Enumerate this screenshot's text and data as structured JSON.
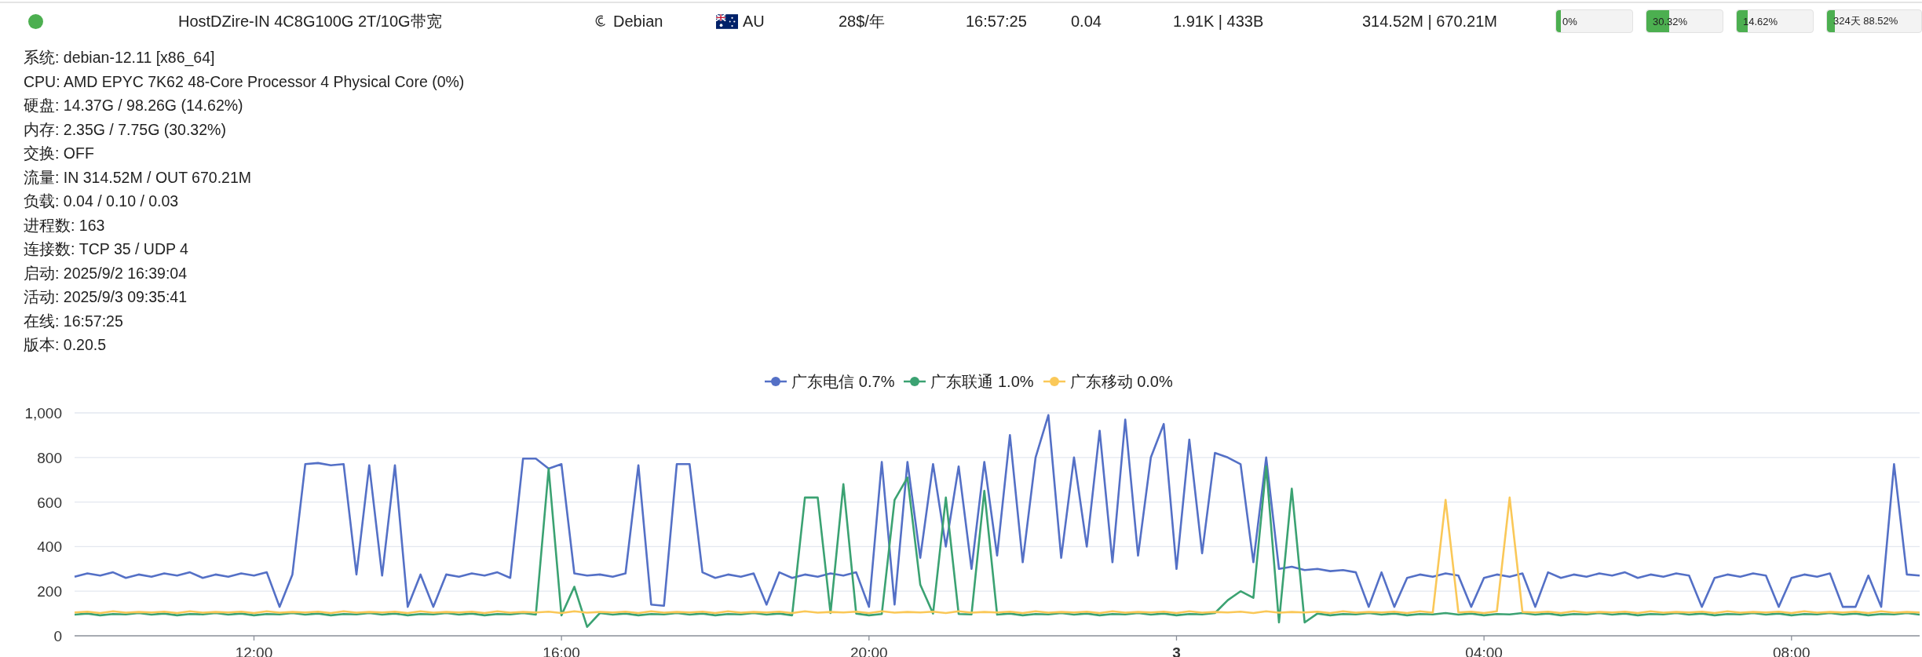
{
  "server": {
    "online": true,
    "name": "HostDZire-IN 4C8G100G 2T/10G带宽",
    "os": "Debian",
    "region": "AU",
    "price": "28$/年",
    "uptime": "16:57:25",
    "load": "0.04",
    "speed": "1.91K | 433B",
    "traffic": "314.52M | 670.21M",
    "bars": [
      {
        "label": "0%",
        "level": 0.0
      },
      {
        "label": "30.32%",
        "level": 0.3032
      },
      {
        "label": "14.62%",
        "level": 0.1462
      },
      {
        "label": "324天 88.52%",
        "level": 0.08
      }
    ]
  },
  "details": [
    "系统: debian-12.11 [x86_64]",
    "CPU: AMD EPYC 7K62 48-Core Processor 4 Physical Core (0%)",
    "硬盘: 14.37G / 98.26G (14.62%)",
    "内存: 2.35G / 7.75G (30.32%)",
    "交换: OFF",
    "流量: IN 314.52M / OUT 670.21M",
    "负载: 0.04 / 0.10 / 0.03",
    "进程数: 163",
    "连接数: TCP 35 / UDP 4",
    "启动: 2025/9/2 16:39:04",
    "活动: 2025/9/3 09:35:41",
    "在线: 16:57:25",
    "版本: 0.20.5"
  ],
  "latency": {
    "chart_data": {
      "type": "line",
      "grid": true,
      "xlim": [
        "2025-09-02 09:40",
        "2025-09-03 09:40"
      ],
      "ylim": [
        0,
        1000
      ],
      "yticks": [
        0,
        200,
        400,
        600,
        800,
        {
          "value": 1000,
          "label": "1,000"
        }
      ],
      "xticks": [
        {
          "value": "2025-09-02 12:00",
          "label": "12:00"
        },
        {
          "value": "2025-09-02 16:00",
          "label": "16:00"
        },
        {
          "value": "2025-09-02 20:00",
          "label": "20:00"
        },
        {
          "value": "2025-09-03 00:00",
          "label": "3"
        },
        {
          "value": "2025-09-03 04:00",
          "label": "04:00"
        },
        {
          "value": "2025-09-03 08:00",
          "label": "08:00"
        }
      ],
      "x": [
        "2025-09-02 09:40",
        "2025-09-02 09:50",
        "2025-09-02 10:00",
        "2025-09-02 10:10",
        "2025-09-02 10:20",
        "2025-09-02 10:30",
        "2025-09-02 10:40",
        "2025-09-02 10:50",
        "2025-09-02 11:00",
        "2025-09-02 11:10",
        "2025-09-02 11:20",
        "2025-09-02 11:30",
        "2025-09-02 11:40",
        "2025-09-02 11:50",
        "2025-09-02 12:00",
        "2025-09-02 12:10",
        "2025-09-02 12:20",
        "2025-09-02 12:30",
        "2025-09-02 12:40",
        "2025-09-02 12:50",
        "2025-09-02 13:00",
        "2025-09-02 13:10",
        "2025-09-02 13:20",
        "2025-09-02 13:30",
        "2025-09-02 13:40",
        "2025-09-02 13:50",
        "2025-09-02 14:00",
        "2025-09-02 14:10",
        "2025-09-02 14:20",
        "2025-09-02 14:30",
        "2025-09-02 14:40",
        "2025-09-02 14:50",
        "2025-09-02 15:00",
        "2025-09-02 15:10",
        "2025-09-02 15:20",
        "2025-09-02 15:30",
        "2025-09-02 15:40",
        "2025-09-02 15:50",
        "2025-09-02 16:00",
        "2025-09-02 16:10",
        "2025-09-02 16:20",
        "2025-09-02 16:30",
        "2025-09-02 16:40",
        "2025-09-02 16:50",
        "2025-09-02 17:00",
        "2025-09-02 17:10",
        "2025-09-02 17:20",
        "2025-09-02 17:30",
        "2025-09-02 17:40",
        "2025-09-02 17:50",
        "2025-09-02 18:00",
        "2025-09-02 18:10",
        "2025-09-02 18:20",
        "2025-09-02 18:30",
        "2025-09-02 18:40",
        "2025-09-02 18:50",
        "2025-09-02 19:00",
        "2025-09-02 19:10",
        "2025-09-02 19:20",
        "2025-09-02 19:30",
        "2025-09-02 19:40",
        "2025-09-02 19:50",
        "2025-09-02 20:00",
        "2025-09-02 20:10",
        "2025-09-02 20:20",
        "2025-09-02 20:30",
        "2025-09-02 20:40",
        "2025-09-02 20:50",
        "2025-09-02 21:00",
        "2025-09-02 21:10",
        "2025-09-02 21:20",
        "2025-09-02 21:30",
        "2025-09-02 21:40",
        "2025-09-02 21:50",
        "2025-09-02 22:00",
        "2025-09-02 22:10",
        "2025-09-02 22:20",
        "2025-09-02 22:30",
        "2025-09-02 22:40",
        "2025-09-02 22:50",
        "2025-09-02 23:00",
        "2025-09-02 23:10",
        "2025-09-02 23:20",
        "2025-09-02 23:30",
        "2025-09-02 23:40",
        "2025-09-02 23:50",
        "2025-09-03 00:00",
        "2025-09-03 00:10",
        "2025-09-03 00:20",
        "2025-09-03 00:30",
        "2025-09-03 00:40",
        "2025-09-03 00:50",
        "2025-09-03 01:00",
        "2025-09-03 01:10",
        "2025-09-03 01:20",
        "2025-09-03 01:30",
        "2025-09-03 01:40",
        "2025-09-03 01:50",
        "2025-09-03 02:00",
        "2025-09-03 02:10",
        "2025-09-03 02:20",
        "2025-09-03 02:30",
        "2025-09-03 02:40",
        "2025-09-03 02:50",
        "2025-09-03 03:00",
        "2025-09-03 03:10",
        "2025-09-03 03:20",
        "2025-09-03 03:30",
        "2025-09-03 03:40",
        "2025-09-03 03:50",
        "2025-09-03 04:00",
        "2025-09-03 04:10",
        "2025-09-03 04:20",
        "2025-09-03 04:30",
        "2025-09-03 04:40",
        "2025-09-03 04:50",
        "2025-09-03 05:00",
        "2025-09-03 05:10",
        "2025-09-03 05:20",
        "2025-09-03 05:30",
        "2025-09-03 05:40",
        "2025-09-03 05:50",
        "2025-09-03 06:00",
        "2025-09-03 06:10",
        "2025-09-03 06:20",
        "2025-09-03 06:30",
        "2025-09-03 06:40",
        "2025-09-03 06:50",
        "2025-09-03 07:00",
        "2025-09-03 07:10",
        "2025-09-03 07:20",
        "2025-09-03 07:30",
        "2025-09-03 07:40",
        "2025-09-03 07:50",
        "2025-09-03 08:00",
        "2025-09-03 08:10",
        "2025-09-03 08:20",
        "2025-09-03 08:30",
        "2025-09-03 08:40",
        "2025-09-03 08:50",
        "2025-09-03 09:00",
        "2025-09-03 09:10",
        "2025-09-03 09:20",
        "2025-09-03 09:30",
        "2025-09-03 09:40"
      ],
      "series": [
        {
          "name": "广东电信 0.7%",
          "color": "#5470c6",
          "values": [
            265,
            280,
            270,
            285,
            260,
            275,
            265,
            280,
            270,
            285,
            260,
            275,
            265,
            280,
            270,
            285,
            130,
            275,
            770,
            775,
            765,
            770,
            275,
            765,
            270,
            765,
            130,
            275,
            130,
            275,
            265,
            280,
            270,
            285,
            260,
            795,
            795,
            750,
            770,
            280,
            270,
            275,
            265,
            280,
            765,
            140,
            135,
            770,
            770,
            285,
            260,
            275,
            265,
            280,
            140,
            285,
            260,
            275,
            265,
            280,
            270,
            285,
            130,
            780,
            140,
            780,
            350,
            770,
            400,
            760,
            300,
            780,
            360,
            900,
            330,
            800,
            990,
            350,
            800,
            400,
            920,
            330,
            970,
            360,
            800,
            950,
            300,
            880,
            370,
            820,
            800,
            770,
            330,
            800,
            300,
            310,
            295,
            300,
            290,
            295,
            285,
            130,
            285,
            130,
            260,
            275,
            265,
            280,
            270,
            130,
            260,
            275,
            265,
            280,
            130,
            285,
            260,
            275,
            265,
            280,
            270,
            285,
            260,
            275,
            265,
            280,
            270,
            130,
            260,
            275,
            265,
            280,
            270,
            130,
            260,
            275,
            265,
            280,
            130,
            130,
            270,
            130,
            770,
            275,
            270
          ]
        },
        {
          "name": "广东联通 1.0%",
          "color": "#3ba272",
          "values": [
            95,
            100,
            92,
            98,
            96,
            102,
            95,
            100,
            92,
            98,
            96,
            102,
            95,
            100,
            92,
            98,
            96,
            102,
            95,
            100,
            92,
            98,
            96,
            102,
            95,
            100,
            92,
            98,
            96,
            102,
            95,
            100,
            92,
            98,
            96,
            102,
            95,
            750,
            92,
            220,
            40,
            102,
            95,
            100,
            92,
            98,
            96,
            102,
            95,
            100,
            92,
            98,
            96,
            102,
            95,
            100,
            92,
            620,
            620,
            102,
            680,
            100,
            92,
            98,
            610,
            710,
            230,
            100,
            620,
            98,
            96,
            650,
            95,
            100,
            92,
            98,
            96,
            102,
            95,
            100,
            92,
            98,
            96,
            102,
            95,
            100,
            92,
            98,
            96,
            102,
            160,
            200,
            170,
            760,
            60,
            660,
            60,
            100,
            92,
            98,
            96,
            102,
            95,
            100,
            92,
            98,
            96,
            102,
            95,
            100,
            92,
            98,
            96,
            102,
            95,
            100,
            92,
            98,
            96,
            102,
            95,
            100,
            92,
            98,
            96,
            102,
            95,
            100,
            92,
            98,
            96,
            102,
            95,
            100,
            92,
            98,
            96,
            102,
            95,
            100,
            92,
            98,
            96,
            102,
            95
          ]
        },
        {
          "name": "广东移动 0.0%",
          "color": "#fac858",
          "values": [
            105,
            108,
            102,
            110,
            104,
            107,
            105,
            108,
            102,
            110,
            104,
            107,
            105,
            108,
            102,
            110,
            104,
            107,
            105,
            108,
            102,
            110,
            104,
            107,
            105,
            108,
            102,
            110,
            104,
            107,
            105,
            108,
            102,
            110,
            104,
            107,
            105,
            108,
            102,
            110,
            104,
            107,
            105,
            108,
            102,
            110,
            104,
            107,
            105,
            108,
            102,
            110,
            104,
            107,
            105,
            108,
            102,
            110,
            104,
            107,
            105,
            108,
            102,
            110,
            104,
            107,
            105,
            108,
            102,
            110,
            104,
            107,
            105,
            108,
            102,
            110,
            104,
            107,
            105,
            108,
            102,
            110,
            104,
            107,
            105,
            108,
            102,
            110,
            104,
            107,
            105,
            108,
            102,
            110,
            104,
            107,
            105,
            108,
            102,
            110,
            104,
            107,
            105,
            108,
            102,
            110,
            104,
            610,
            105,
            108,
            102,
            110,
            620,
            107,
            105,
            108,
            102,
            110,
            104,
            107,
            105,
            108,
            102,
            110,
            104,
            107,
            105,
            108,
            102,
            110,
            104,
            107,
            105,
            108,
            102,
            110,
            104,
            107,
            105,
            108,
            102,
            110,
            104,
            107,
            105
          ]
        }
      ]
    }
  }
}
